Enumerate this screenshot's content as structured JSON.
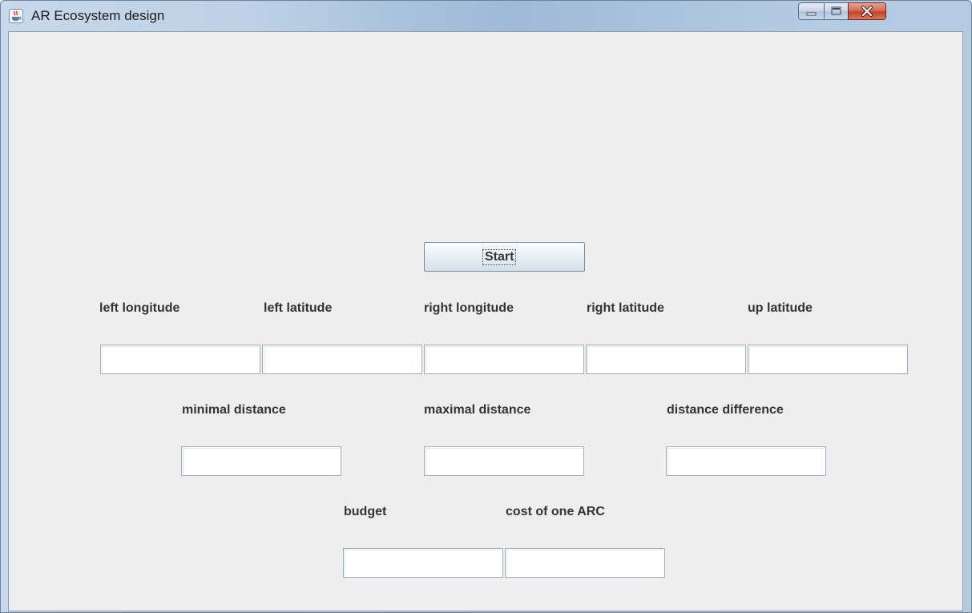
{
  "window": {
    "title": "AR Ecosystem design",
    "icon": "java-cup-icon",
    "controls": {
      "minimize": "minimize-icon",
      "maximize": "maximize-icon",
      "close": "close-icon"
    }
  },
  "start_button": {
    "label": "Start"
  },
  "coordinates": {
    "left_longitude": {
      "label": "left longitude",
      "value": ""
    },
    "left_latitude": {
      "label": "left latitude",
      "value": ""
    },
    "right_longitude": {
      "label": "right longitude",
      "value": ""
    },
    "right_latitude": {
      "label": "right latitude",
      "value": ""
    },
    "up_latitude": {
      "label": "up latitude",
      "value": ""
    }
  },
  "distances": {
    "minimal": {
      "label": "minimal distance",
      "value": ""
    },
    "maximal": {
      "label": "maximal distance",
      "value": ""
    },
    "difference": {
      "label": "distance difference",
      "value": ""
    }
  },
  "cost": {
    "budget": {
      "label": "budget",
      "value": ""
    },
    "arc_cost": {
      "label": "cost of one ARC",
      "value": ""
    }
  }
}
